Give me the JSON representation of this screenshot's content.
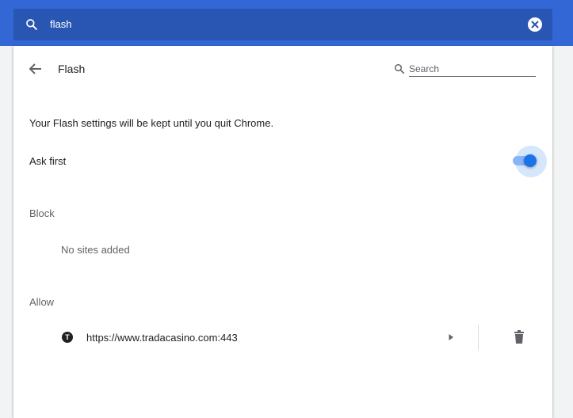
{
  "search": {
    "query": "flash",
    "icon": "search-icon",
    "clear_icon": "close-icon"
  },
  "page": {
    "title": "Flash",
    "back_icon": "arrow-back-icon",
    "search_placeholder": "Search"
  },
  "settings": {
    "note": "Your Flash settings will be kept until you quit Chrome.",
    "ask_first_label": "Ask first",
    "ask_first_enabled": true
  },
  "block": {
    "heading": "Block",
    "empty_text": "No sites added"
  },
  "allow": {
    "heading": "Allow",
    "sites": [
      {
        "favicon_letter": "T",
        "url": "https://www.tradacasino.com:443"
      }
    ]
  },
  "colors": {
    "topbar": "#3367d6",
    "search_box": "#2a56b3",
    "toggle_on": "#1a73e8"
  }
}
